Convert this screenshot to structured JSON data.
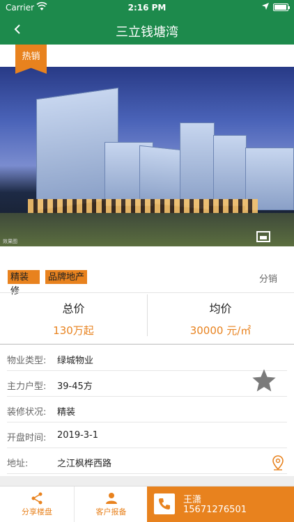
{
  "status": {
    "carrier": "Carrier",
    "time": "2:16 PM"
  },
  "nav": {
    "title": "三立钱塘湾",
    "back_glyph": "<"
  },
  "hero": {
    "badge": "热销",
    "credit": "效果图"
  },
  "tags": {
    "items": [
      "精装修",
      "品牌地产"
    ],
    "right": "分销"
  },
  "price": {
    "total_label": "总价",
    "total_value": "130万起",
    "avg_label": "均价",
    "avg_value": "30000 元/㎡"
  },
  "info": {
    "rows": [
      {
        "key": "物业类型:",
        "value": "绿城物业"
      },
      {
        "key": "主力户型:",
        "value": "39-45方"
      },
      {
        "key": "装修状况:",
        "value": "精装"
      },
      {
        "key": "开盘时间:",
        "value": "2019-3-1"
      },
      {
        "key": "地址:",
        "value": "之江枫桦西路"
      }
    ]
  },
  "bottom": {
    "share_label": "分享楼盘",
    "report_label": "客户报备",
    "agent_name": "王潇",
    "agent_phone": "15671276501"
  },
  "colors": {
    "brand_green": "#1d8a4c",
    "accent_orange": "#e8821e"
  },
  "icons": [
    "wifi-icon",
    "location-arrow-icon",
    "battery-icon",
    "back-chevron-icon",
    "photo-gallery-icon",
    "star-icon",
    "map-pin-icon",
    "share-icon",
    "customer-report-icon",
    "phone-icon"
  ]
}
